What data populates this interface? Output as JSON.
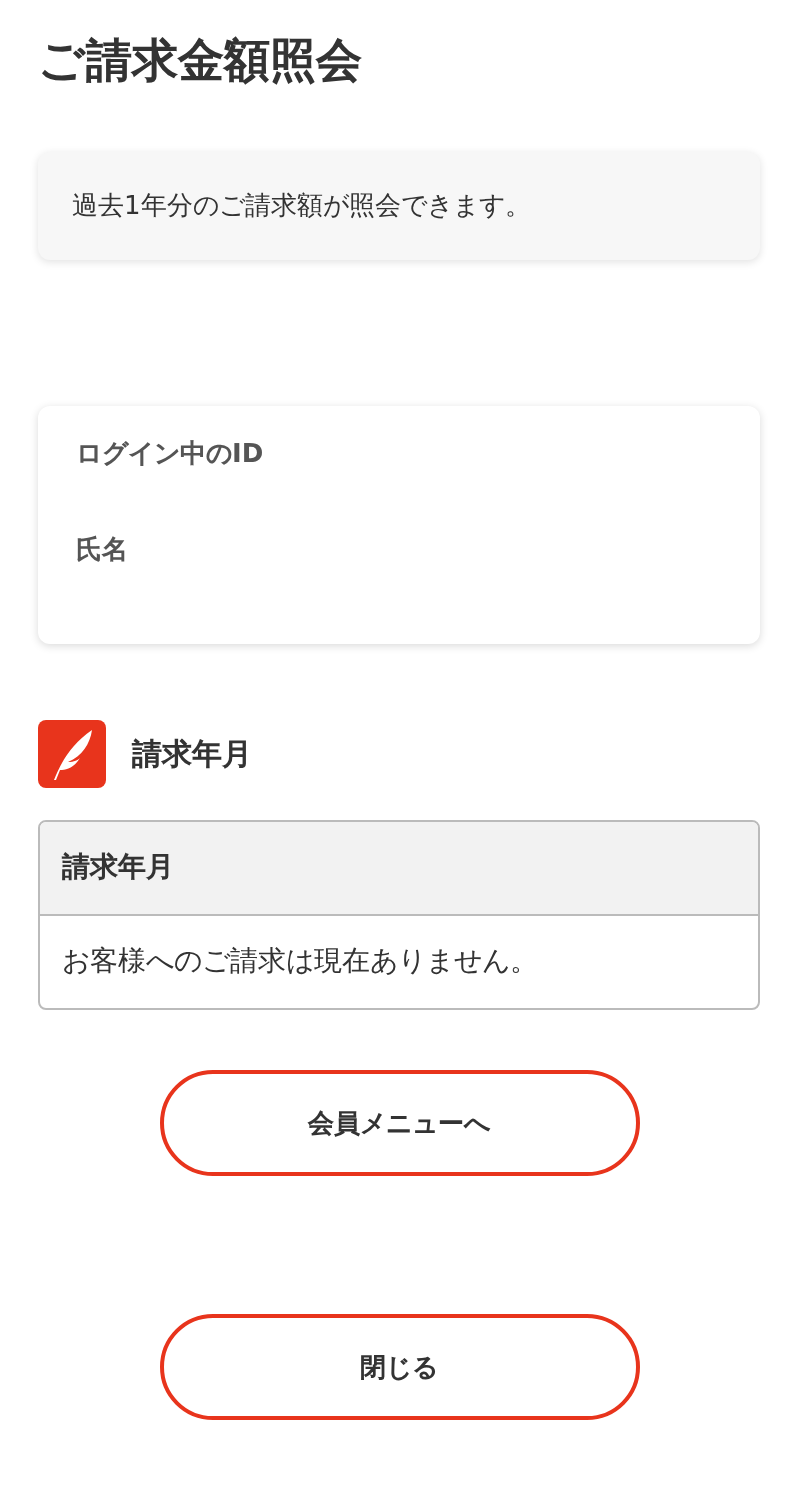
{
  "title": "ご請求金額照会",
  "notice": "過去1年分のご請求額が照会できます。",
  "profile": {
    "fields": [
      {
        "label": "ログイン中のID"
      },
      {
        "label": "氏名"
      }
    ]
  },
  "section": {
    "title": "請求年月"
  },
  "table": {
    "columns": [
      "請求年月"
    ],
    "empty_message": "お客様へのご請求は現在ありません。"
  },
  "buttons": [
    {
      "label": "会員メニューへ"
    },
    {
      "label": "閉じる"
    }
  ]
}
